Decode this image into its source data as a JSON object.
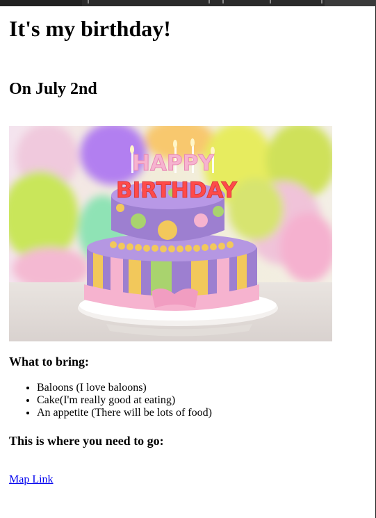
{
  "page": {
    "title": "It's my birthday!",
    "date_heading": "On July 2nd",
    "image": {
      "cake_topper": [
        "HAPPY",
        "BIRTHDAY"
      ],
      "colors": {
        "cake_purple": "#9d7fd0",
        "frosting_pink": "#f6b3cf",
        "stripe_yellow": "#f2c85b",
        "stripe_green": "#a9d36e",
        "balloon_lime": "#cfe15a",
        "balloon_purple": "#b27ff0"
      }
    },
    "bring_heading": "What to bring:",
    "bring_items": [
      "Baloons (I love baloons)",
      "Cake(I'm really good at eating)",
      "An appetite (There will be lots of food)"
    ],
    "where_heading": "This is where you need to go:",
    "map_link": "Map Link"
  }
}
